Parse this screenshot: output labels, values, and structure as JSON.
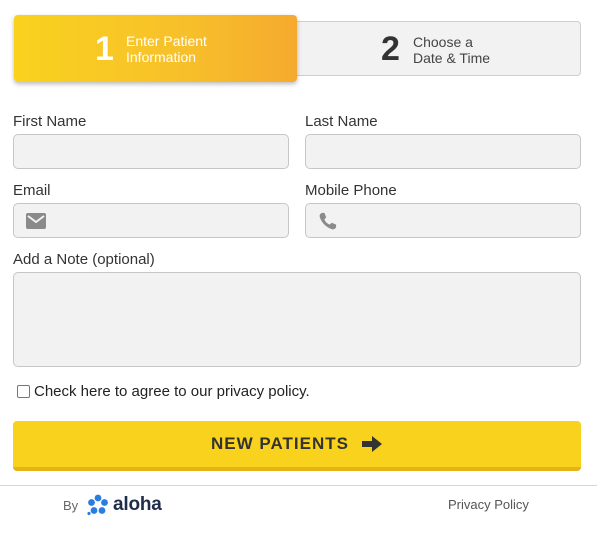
{
  "steps": [
    {
      "number": "1",
      "line1": "Enter Patient",
      "line2": "Information"
    },
    {
      "number": "2",
      "line1": "Choose a",
      "line2": "Date & Time"
    }
  ],
  "form": {
    "first_name_label": "First Name",
    "last_name_label": "Last Name",
    "email_label": "Email",
    "phone_label": "Mobile Phone",
    "note_label": "Add a Note (optional)",
    "first_name_value": "",
    "last_name_value": "",
    "email_value": "",
    "phone_value": "",
    "note_value": ""
  },
  "agree": {
    "text": "Check here to agree to our privacy policy."
  },
  "cta": {
    "label": "NEW PATIENTS"
  },
  "footer": {
    "by": "By",
    "brand": "aloha",
    "privacy_link": "Privacy Policy"
  },
  "colors": {
    "accent": "#f9d21e",
    "accent_dark": "#f5aa2f",
    "brand_blue": "#2a7de1"
  },
  "icons": {
    "email": "mail-icon",
    "phone": "phone-icon",
    "cta": "arrow-right-icon",
    "brand": "aloha-flower-icon"
  }
}
